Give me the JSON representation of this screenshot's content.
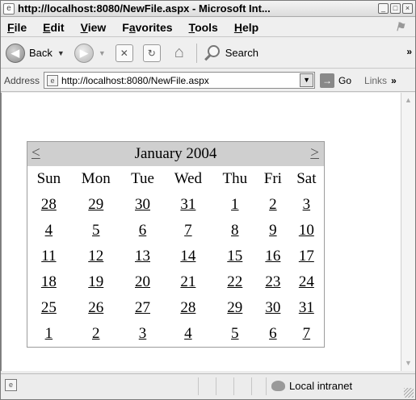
{
  "window": {
    "title": "http://localhost:8080/NewFile.aspx - Microsoft Int...",
    "controls": [
      "_",
      "□",
      "×"
    ]
  },
  "menu": {
    "items": [
      {
        "u": "F",
        "rest": "ile"
      },
      {
        "u": "E",
        "rest": "dit"
      },
      {
        "u": "V",
        "rest": "iew"
      },
      {
        "pre": "F",
        "u": "a",
        "rest": "vorites"
      },
      {
        "u": "T",
        "rest": "ools"
      },
      {
        "u": "H",
        "rest": "elp"
      }
    ]
  },
  "toolbar": {
    "back_label": "Back",
    "search_label": "Search",
    "overflow": "»"
  },
  "address": {
    "label": "Address",
    "url": "http://localhost:8080/NewFile.aspx",
    "go_label": "Go",
    "links_label": "Links",
    "links_more": "»"
  },
  "calendar": {
    "title": "January 2004",
    "prev": "<",
    "next": ">",
    "weekdays": [
      "Sun",
      "Mon",
      "Tue",
      "Wed",
      "Thu",
      "Fri",
      "Sat"
    ],
    "weeks": [
      [
        "28",
        "29",
        "30",
        "31",
        "1",
        "2",
        "3"
      ],
      [
        "4",
        "5",
        "6",
        "7",
        "8",
        "9",
        "10"
      ],
      [
        "11",
        "12",
        "13",
        "14",
        "15",
        "16",
        "17"
      ],
      [
        "18",
        "19",
        "20",
        "21",
        "22",
        "23",
        "24"
      ],
      [
        "25",
        "26",
        "27",
        "28",
        "29",
        "30",
        "31"
      ],
      [
        "1",
        "2",
        "3",
        "4",
        "5",
        "6",
        "7"
      ]
    ]
  },
  "status": {
    "zone_label": "Local intranet"
  }
}
